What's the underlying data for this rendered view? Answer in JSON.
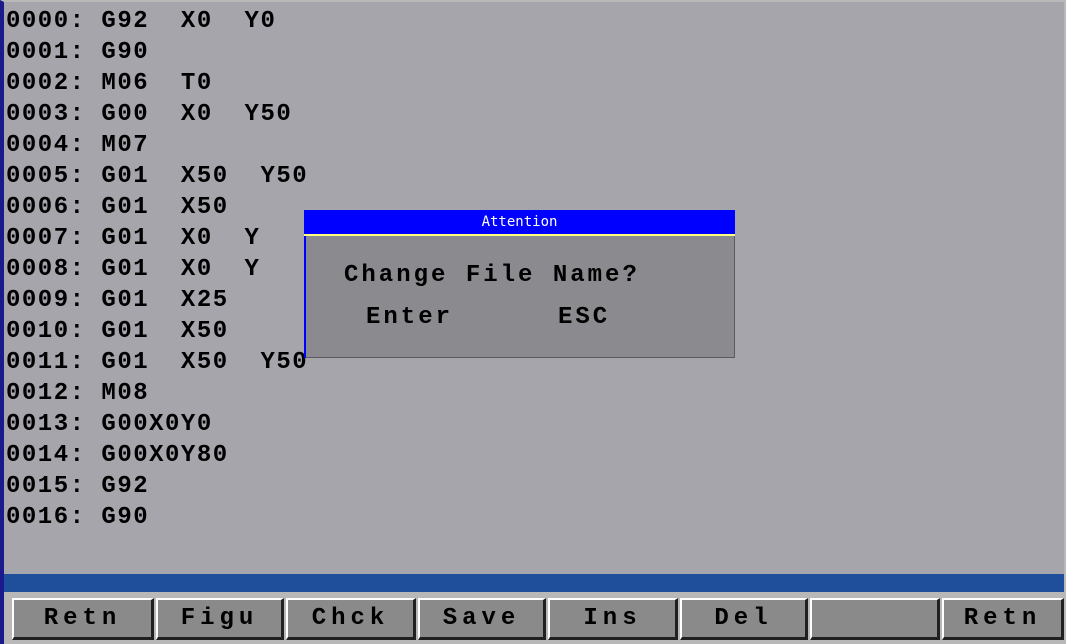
{
  "program": {
    "lines": [
      "0000: G92  X0  Y0",
      "0001: G90",
      "0002: M06  T0",
      "0003: G00  X0  Y50",
      "0004: M07",
      "0005: G01  X50  Y50",
      "0006: G01  X50",
      "0007: G01  X0  Y",
      "0008: G01  X0  Y",
      "0009: G01  X25",
      "0010: G01  X50",
      "0011: G01  X50  Y50",
      "0012: M08",
      "0013: G00X0Y0",
      "0014: G00X0Y80",
      "0015: G92",
      "0016: G90"
    ]
  },
  "dialog": {
    "title": "Attention",
    "message": "Change File Name?",
    "enter_label": "Enter",
    "esc_label": "ESC"
  },
  "function_keys": [
    "Retn",
    "Figu",
    "Chck",
    "Save",
    "Ins",
    "Del",
    "",
    "Retn"
  ],
  "colors": {
    "screen_background": "#a6a5ac",
    "dialog_background": "#8b8b8f",
    "dialog_titlebar": "#0000ff",
    "status_bar": "#1f4f9a",
    "key_face": "#8a8a8a"
  }
}
